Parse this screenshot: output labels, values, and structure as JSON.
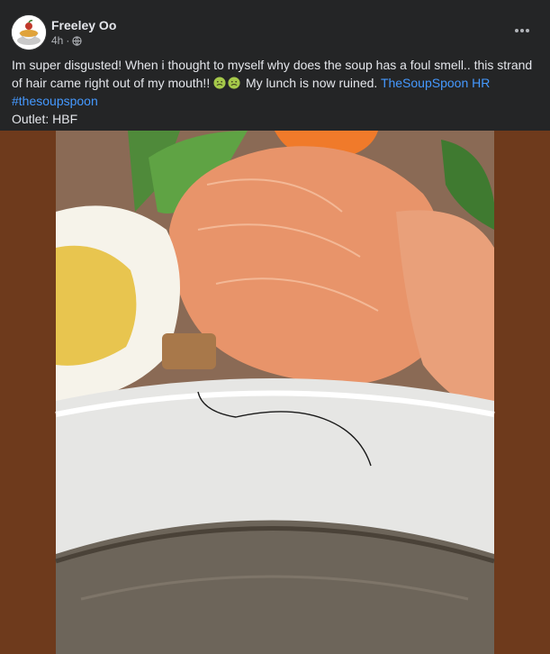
{
  "post": {
    "author": "Freeley Oo",
    "time": "4h",
    "more_icon": "more-horizontal-icon",
    "audience_icon": "globe-icon",
    "text_main": "Im super disgusted! When i thought to myself why does the soup has a foul smell.. this strand of hair came right out of my mouth!!",
    "emoji": "nauseated-face-emoji",
    "text_after_emoji": "My lunch is now ruined.",
    "mention": "TheSoupSpoon HR",
    "hashtag": "#thesoupspoon",
    "outlet_line": "Outlet: HBF"
  },
  "colors": {
    "background": "#242526",
    "text": "#e4e6eb",
    "secondary_text": "#b0b3b8",
    "link": "#4599ff",
    "photo_backdrop": "#6b3a1f"
  }
}
